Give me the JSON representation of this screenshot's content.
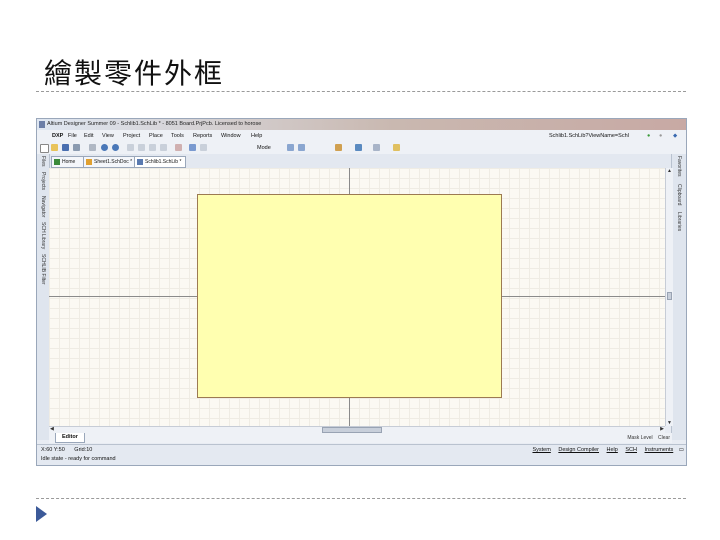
{
  "slide": {
    "title": "繪製零件外框"
  },
  "app": {
    "title": "Altium Designer Summer 09 - Schlib1.SchLib * - 8051 Board.PrjPcb. Licensed to horose",
    "menu": [
      "DXP",
      "File",
      "Edit",
      "View",
      "Project",
      "Place",
      "Tools",
      "Reports",
      "Window",
      "Help"
    ],
    "address": "Schlib1.SchLib?ViewName=Schl",
    "toolbar_mode": "Mode",
    "tabs": [
      "Home",
      "Sheet1.SchDoc *",
      "Schlib1.SchLib *"
    ],
    "left_panels": [
      "Files",
      "Projects",
      "Navigator",
      "SCH Library",
      "SCHLIB Filter"
    ],
    "right_panels": [
      "Favorites",
      "Clipboard",
      "Libraries"
    ],
    "editor_tab": "Editor",
    "mask_level": "Mask Level",
    "clear": "Clear",
    "status_coord": "X:60 Y:50",
    "status_grid": "Grid:10",
    "status_panels": [
      "System",
      "Design Compiler",
      "Help",
      "SCH",
      "Instruments"
    ],
    "status_message": "Idle state - ready for command"
  },
  "colors": {
    "component_fill": "#ffffb0",
    "component_border": "#9c7a52",
    "canvas": "#fbf9f3",
    "bullet": "#3c5a99"
  }
}
